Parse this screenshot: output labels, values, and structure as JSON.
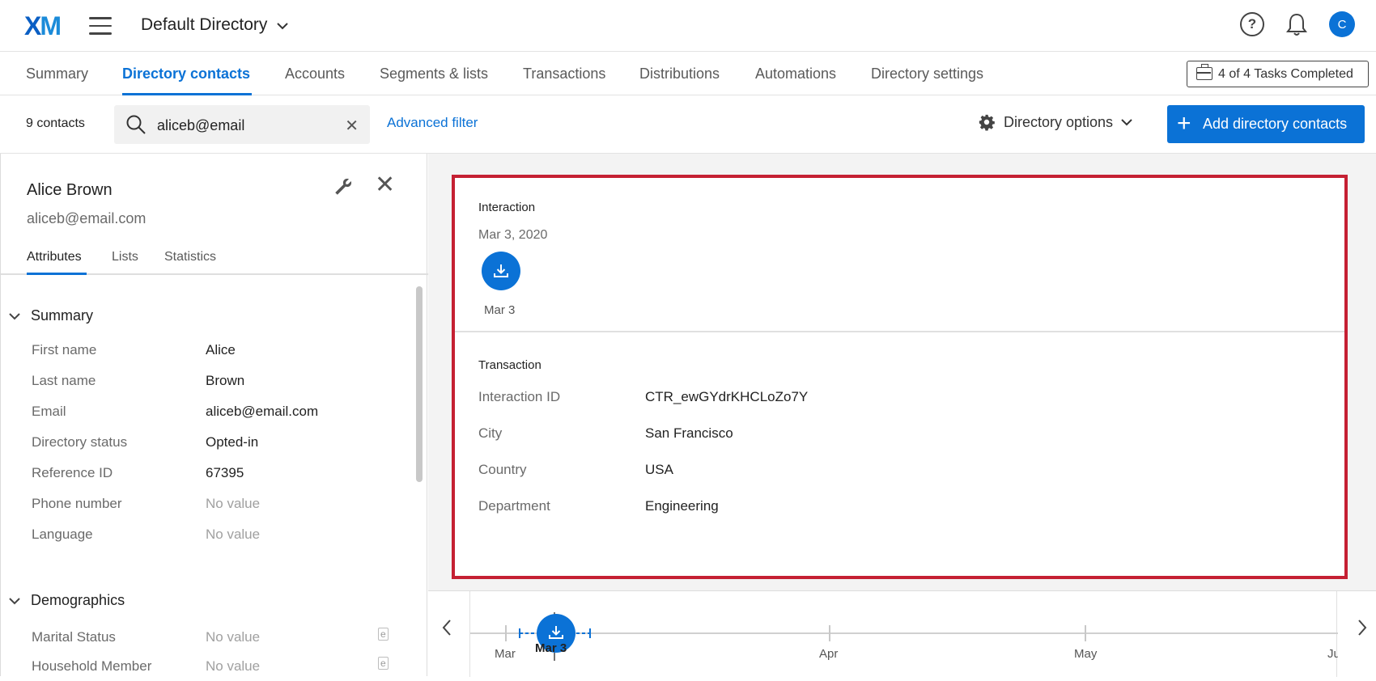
{
  "app": {
    "logo_x": "X",
    "logo_m": "M",
    "directory_title": "Default Directory",
    "avatar_letter": "C",
    "help_glyph": "?"
  },
  "nav": {
    "tabs": [
      {
        "label": "Summary"
      },
      {
        "label": "Directory contacts"
      },
      {
        "label": "Accounts"
      },
      {
        "label": "Segments & lists"
      },
      {
        "label": "Transactions"
      },
      {
        "label": "Distributions"
      },
      {
        "label": "Automations"
      },
      {
        "label": "Directory settings"
      }
    ],
    "active_tab": "Directory contacts",
    "tasks_label": "4 of 4 Tasks Completed"
  },
  "filterbar": {
    "contacts_count": "9 contacts",
    "search_value": "aliceb@email",
    "advanced_filter": "Advanced filter",
    "directory_options": "Directory options",
    "add_button": "Add directory contacts"
  },
  "contact": {
    "name": "Alice Brown",
    "email": "aliceb@email.com",
    "tabs": [
      {
        "label": "Attributes"
      },
      {
        "label": "Lists"
      },
      {
        "label": "Statistics"
      }
    ],
    "active_tab": "Attributes",
    "summary": {
      "title": "Summary",
      "rows": [
        {
          "label": "First name",
          "value": "Alice",
          "empty": false
        },
        {
          "label": "Last name",
          "value": "Brown",
          "empty": false
        },
        {
          "label": "Email",
          "value": "aliceb@email.com",
          "empty": false
        },
        {
          "label": "Directory status",
          "value": "Opted-in",
          "empty": false
        },
        {
          "label": "Reference ID",
          "value": "67395",
          "empty": false
        },
        {
          "label": "Phone number",
          "value": "No value",
          "empty": true
        },
        {
          "label": "Language",
          "value": "No value",
          "empty": true
        }
      ]
    },
    "demographics": {
      "title": "Demographics",
      "badge": "e",
      "rows": [
        {
          "label": "Marital Status",
          "value": "No value",
          "empty": true
        },
        {
          "label": "Household Member",
          "value": "No value",
          "empty": true
        }
      ]
    }
  },
  "interaction": {
    "label": "Interaction",
    "date": "Mar 3, 2020",
    "event_label": "Mar 3",
    "event_icon": "download-icon"
  },
  "transaction": {
    "label": "Transaction",
    "rows": [
      {
        "label": "Interaction ID",
        "value": "CTR_ewGYdrKHCLoZo7Y"
      },
      {
        "label": "City",
        "value": "San Francisco"
      },
      {
        "label": "Country",
        "value": "USA"
      },
      {
        "label": "Department",
        "value": "Engineering"
      }
    ]
  },
  "timeline": {
    "months": [
      {
        "label": "Mar"
      },
      {
        "label": "Apr"
      },
      {
        "label": "May"
      },
      {
        "label": "Ju"
      }
    ],
    "event_label": "Mar 3"
  },
  "colors": {
    "accent": "#0b72d6",
    "highlight_border": "#c52033"
  }
}
